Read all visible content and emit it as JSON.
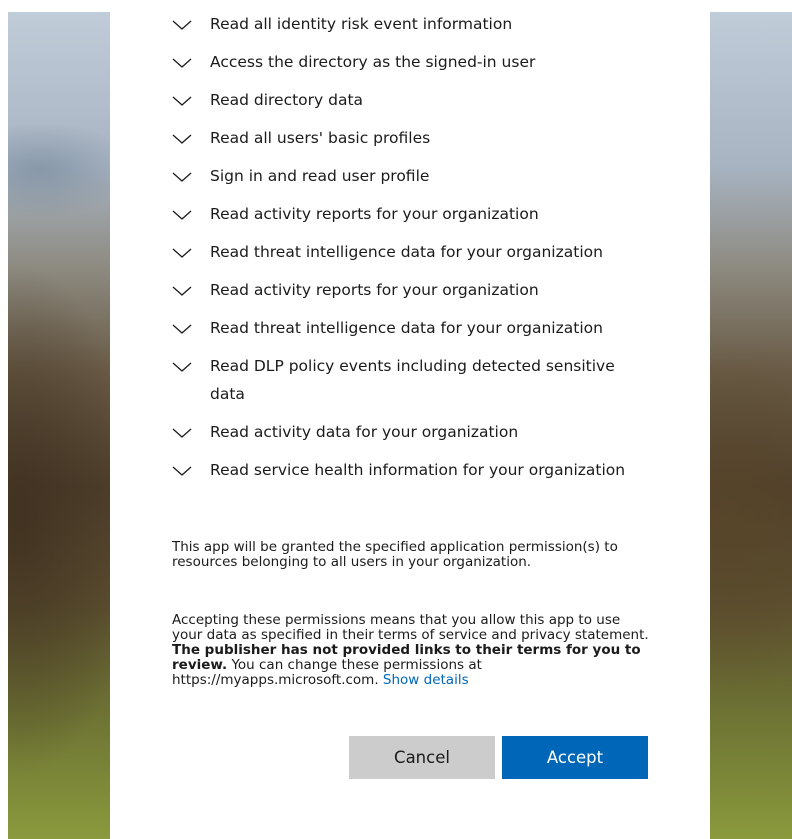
{
  "permissions": [
    {
      "label": "Read all identity risk event information"
    },
    {
      "label": "Access the directory as the signed-in user"
    },
    {
      "label": "Read directory data"
    },
    {
      "label": "Read all users' basic profiles"
    },
    {
      "label": "Sign in and read user profile"
    },
    {
      "label": "Read activity reports for your organization"
    },
    {
      "label": "Read threat intelligence data for your organization"
    },
    {
      "label": "Read activity reports for your organization"
    },
    {
      "label": "Read threat intelligence data for your organization"
    },
    {
      "label": "Read DLP policy events including detected sensitive data"
    },
    {
      "label": "Read activity data for your organization"
    },
    {
      "label": "Read service health information for your organization"
    }
  ],
  "info": {
    "app_permissions_text": "This app will be granted the specified application permission(s) to resources belonging to all users in your organization.",
    "consent_text_1": "Accepting these permissions means that you allow this app to use your data as specified in their terms of service and privacy statement.",
    "consent_bold": "The publisher has not provided links to their terms for you to review.",
    "consent_text_2": "You can change these permissions at https://myapps.microsoft.com.",
    "show_details_link": "Show details"
  },
  "buttons": {
    "cancel_label": "Cancel",
    "accept_label": "Accept"
  },
  "icons": {
    "expand": "chevron-down-icon"
  },
  "colors": {
    "accent": "#0067b8",
    "cancel_bg": "#cccccc"
  }
}
